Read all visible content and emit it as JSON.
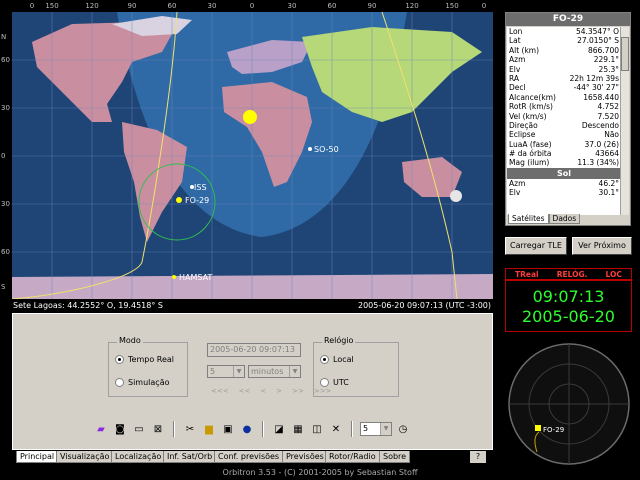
{
  "app": {
    "footer": "Orbitron 3.53 - (C) 2001-2005 by Sebastian Stoff"
  },
  "map": {
    "top_scale": [
      "0",
      "150",
      "120",
      "90",
      "60",
      "30",
      "0",
      "30",
      "60",
      "90",
      "120",
      "150",
      "0"
    ],
    "left_scale": [
      "N",
      "60",
      "30",
      "0",
      "30",
      "60",
      "S"
    ],
    "satellites": [
      {
        "name": "SO-50",
        "color": "#ffffff"
      },
      {
        "name": "ISS",
        "color": "#ffffff"
      },
      {
        "name": "FO-29",
        "color": "#ffff00"
      },
      {
        "name": "HAMSAT",
        "color": "#ffffff"
      }
    ],
    "location_label": "Sete Lagoas: 44.2552° O, 19.4518° S",
    "datetime_label": "2005-06-20 09:07:13 (UTC -3:00)"
  },
  "panel": {
    "modo": {
      "title": "Modo",
      "options": [
        "Tempo Real",
        "Simulação"
      ],
      "selected": "Tempo Real"
    },
    "sim_datetime": "2005-06-20 09:07:13",
    "step_value": "5",
    "step_unit": "minutos",
    "nav_buttons": [
      "<<<",
      "<<",
      "<",
      ">",
      ">>",
      ">>>"
    ],
    "relogio": {
      "title": "Relógio",
      "options": [
        "Local",
        "UTC"
      ],
      "selected": "Local"
    },
    "toolbar_icons": [
      "book-icon",
      "camera-icon",
      "window-icon",
      "close-window-icon",
      "tools-icon",
      "folder-open-icon",
      "save-icon",
      "info-icon",
      "fill-icon",
      "grid-icon",
      "ruler-icon",
      "cross-icon",
      "clock-icon"
    ],
    "speed_value": "5"
  },
  "tabs": [
    "Principal",
    "Visualização",
    "Localização",
    "Inf. Sat/Orb",
    "Conf. previsões",
    "Previsões",
    "Rotor/Radio",
    "Sobre"
  ],
  "active_tab": "Principal",
  "help_label": "?",
  "info": {
    "title": "FO-29",
    "rows": [
      {
        "k": "Lon",
        "v": "54.3547° O"
      },
      {
        "k": "Lat",
        "v": "27.0150° S"
      },
      {
        "k": "Alt (km)",
        "v": "866.700"
      },
      {
        "k": "Azm",
        "v": "229.1°"
      },
      {
        "k": "Elv",
        "v": "25.3°"
      },
      {
        "k": "RA",
        "v": "22h 12m 39s"
      },
      {
        "k": "Decl",
        "v": "-44° 30' 27\""
      },
      {
        "k": "Alcance(km)",
        "v": "1658.440"
      },
      {
        "k": "RotR (km/s)",
        "v": "4.752"
      },
      {
        "k": "Vel (km/s)",
        "v": "7.520"
      },
      {
        "k": "Direção",
        "v": "Descendo"
      },
      {
        "k": "Eclipse",
        "v": "Não"
      },
      {
        "k": "LuaA (fase)",
        "v": "37.0 (26)"
      },
      {
        "k": "# da órbita",
        "v": "43664"
      },
      {
        "k": "Mag (ilum)",
        "v": "11.3 (34%)"
      }
    ],
    "sub_title": "Sol",
    "sub_rows": [
      {
        "k": "Azm",
        "v": "46.2°"
      },
      {
        "k": "Elv",
        "v": "30.1°"
      }
    ],
    "tabs": [
      "Satélites",
      "Dados"
    ],
    "active_tab": "Satélites"
  },
  "buttons": {
    "load_tle": "Carregar TLE",
    "next": "Ver Próximo"
  },
  "clock": {
    "labels": [
      "TReal",
      "RELÓG.",
      "LOC"
    ],
    "time": "09:07:13",
    "date": "2005-06-20"
  },
  "radar": {
    "sat_label": "FO-29"
  },
  "colors": {
    "ocean": "#2f6aa6",
    "night": "#1b3a66",
    "clock_text": "#2dff2d",
    "clock_label": "#ff3b3b",
    "panel": "#d4d0c8"
  }
}
